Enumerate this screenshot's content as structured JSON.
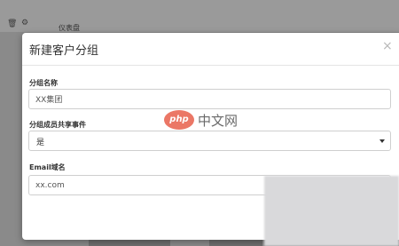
{
  "background": {
    "trash_glyph": "🗑",
    "gear_glyph": "⚙",
    "label": "仪表盘"
  },
  "modal": {
    "title": "新建客户分组",
    "close_glyph": "×",
    "fields": {
      "group_name": {
        "label": "分组名称",
        "value": "XX集团"
      },
      "shared_events": {
        "label": "分组成员共享事件",
        "selected": "是"
      },
      "email_domain": {
        "label": "Email域名",
        "value": "xx.com"
      }
    }
  },
  "watermark": {
    "logo": "php",
    "text": "中文网"
  },
  "colors": {
    "overlay": "#8a8a8a",
    "modal_bg": "#ffffff",
    "input_border": "#cfcfcf",
    "brand": "#e8604c"
  },
  "icons": [
    "trash-icon",
    "gear-icon",
    "close-icon",
    "caret-down-icon"
  ]
}
